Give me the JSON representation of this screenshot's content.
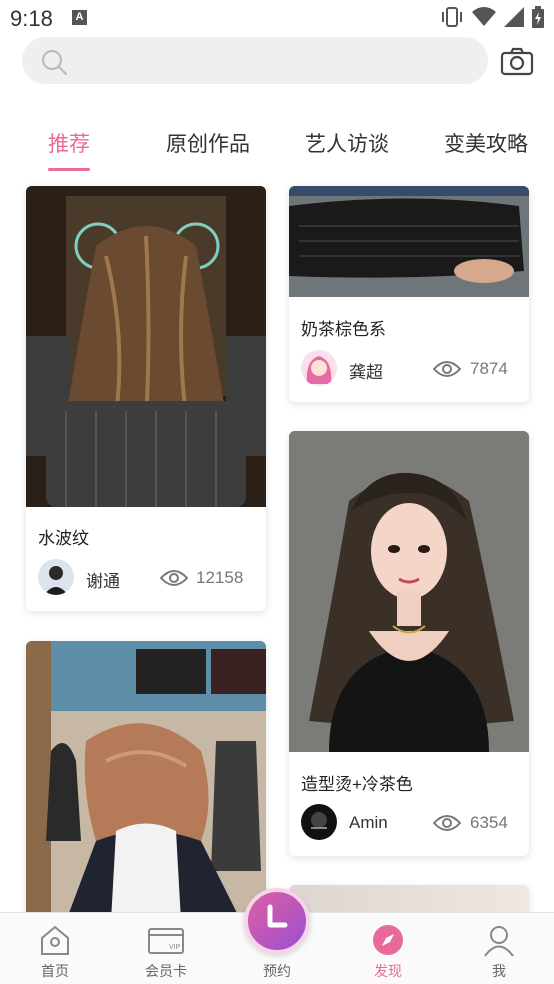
{
  "status_bar": {
    "time": "9:18",
    "notification_letter": "A"
  },
  "search": {
    "placeholder": ""
  },
  "tabs": [
    {
      "label": "推荐",
      "active": true
    },
    {
      "label": "原创作品",
      "active": false
    },
    {
      "label": "艺人访谈",
      "active": false
    },
    {
      "label": "变美攻略",
      "active": false
    }
  ],
  "cards": [
    {
      "title": "水波纹",
      "author": "谢通",
      "views": "12158"
    },
    {
      "title": "奶茶棕色系",
      "author": "龚超",
      "views": "7874"
    },
    {
      "title": "造型烫+冷茶色",
      "author": "Amin",
      "views": "6354"
    },
    {
      "title": "",
      "author": "",
      "views": ""
    },
    {
      "title": "",
      "author": "",
      "views": ""
    }
  ],
  "bottom_nav": {
    "items": [
      {
        "label": "首页",
        "icon": "home-icon"
      },
      {
        "label": "会员卡",
        "icon": "vip-card-icon"
      },
      {
        "label": "预约",
        "icon": "clock-icon"
      },
      {
        "label": "发现",
        "icon": "compass-icon"
      },
      {
        "label": "我",
        "icon": "user-icon"
      }
    ],
    "vip_text": "VIP"
  },
  "colors": {
    "accent": "#e86a9b",
    "search_bg": "#efefef"
  }
}
